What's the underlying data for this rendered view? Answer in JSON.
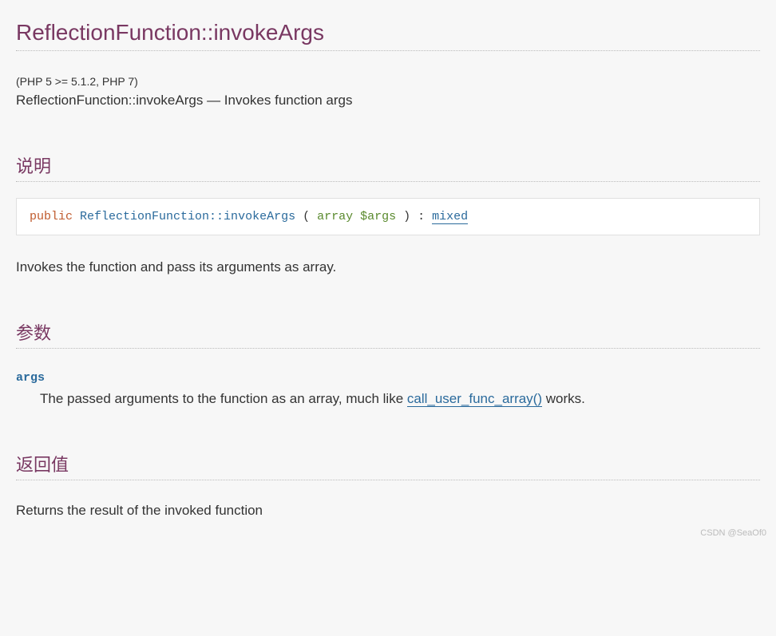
{
  "title": "ReflectionFunction::invokeArgs",
  "version": "(PHP 5 >= 5.1.2, PHP 7)",
  "summary_name": "ReflectionFunction::invokeArgs",
  "summary_sep": " — ",
  "summary_desc": "Invokes function args",
  "section_desc_heading": "说明",
  "synopsis": {
    "modifier": "public",
    "method": "ReflectionFunction::invokeArgs",
    "open": " ( ",
    "param_type": "array",
    "param_var": "$args",
    "close": " ) : ",
    "return_type": "mixed"
  },
  "desc_text": "Invokes the function and pass its arguments as array.",
  "section_params_heading": "参数",
  "param_name": "args",
  "param_desc_prefix": "The passed arguments to the function as an array, much like ",
  "param_desc_link": "call_user_func_array()",
  "param_desc_suffix": " works.",
  "section_return_heading": "返回值",
  "return_text": "Returns the result of the invoked function",
  "watermark": "CSDN @SeaOf0"
}
